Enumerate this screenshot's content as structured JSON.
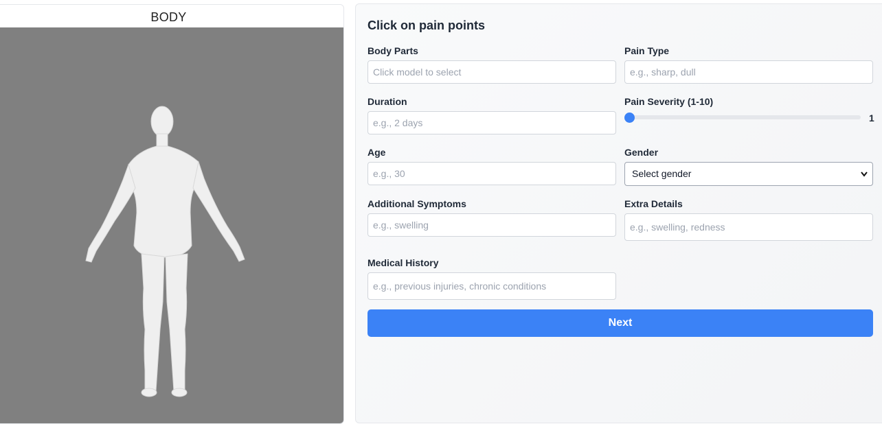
{
  "left": {
    "title": "BODY",
    "viewport_background": "#808080",
    "model_color": "#eeeeee"
  },
  "form": {
    "title": "Click on pain points",
    "body_parts": {
      "label": "Body Parts",
      "placeholder": "Click model to select"
    },
    "pain_type": {
      "label": "Pain Type",
      "placeholder": "e.g., sharp, dull"
    },
    "duration": {
      "label": "Duration",
      "placeholder": "e.g., 2 days"
    },
    "pain_severity": {
      "label": "Pain Severity (1-10)",
      "value": "1",
      "min": 1,
      "max": 10
    },
    "age": {
      "label": "Age",
      "placeholder": "e.g., 30"
    },
    "gender": {
      "label": "Gender",
      "selected": "Select gender"
    },
    "additional_symptoms": {
      "label": "Additional Symptoms",
      "placeholder": "e.g., swelling"
    },
    "extra_details": {
      "label": "Extra Details",
      "placeholder": "e.g., swelling, redness"
    },
    "medical_history": {
      "label": "Medical History",
      "placeholder": "e.g., previous injuries, chronic conditions"
    },
    "next_label": "Next",
    "accent_color": "#3b82f6"
  }
}
